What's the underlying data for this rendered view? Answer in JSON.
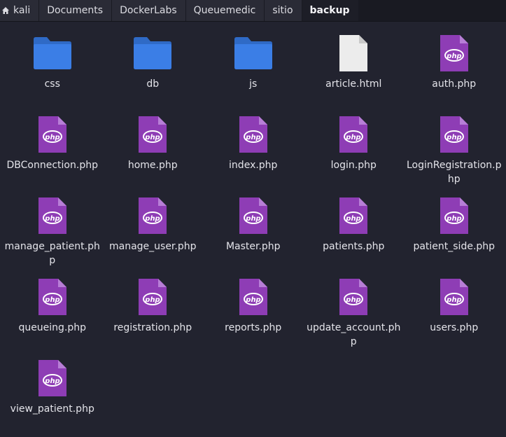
{
  "breadcrumbs": [
    {
      "label": "kali",
      "icon": "home-icon"
    },
    {
      "label": "Documents"
    },
    {
      "label": "DockerLabs"
    },
    {
      "label": "Queuemedic"
    },
    {
      "label": "sitio"
    },
    {
      "label": "backup",
      "active": true
    }
  ],
  "colors": {
    "folder": "#3b7ee6",
    "php": "#8e3db5",
    "html": "#ececec"
  },
  "php_badge_text": "php",
  "files": [
    {
      "name": "css",
      "type": "folder"
    },
    {
      "name": "db",
      "type": "folder"
    },
    {
      "name": "js",
      "type": "folder"
    },
    {
      "name": "article.html",
      "type": "html"
    },
    {
      "name": "auth.php",
      "type": "php"
    },
    {
      "name": "DBConnection.php",
      "type": "php"
    },
    {
      "name": "home.php",
      "type": "php"
    },
    {
      "name": "index.php",
      "type": "php"
    },
    {
      "name": "login.php",
      "type": "php"
    },
    {
      "name": "LoginRegistration.php",
      "type": "php"
    },
    {
      "name": "manage_patient.php",
      "type": "php"
    },
    {
      "name": "manage_user.php",
      "type": "php"
    },
    {
      "name": "Master.php",
      "type": "php"
    },
    {
      "name": "patients.php",
      "type": "php"
    },
    {
      "name": "patient_side.php",
      "type": "php"
    },
    {
      "name": "queueing.php",
      "type": "php"
    },
    {
      "name": "registration.php",
      "type": "php"
    },
    {
      "name": "reports.php",
      "type": "php"
    },
    {
      "name": "update_account.php",
      "type": "php"
    },
    {
      "name": "users.php",
      "type": "php"
    },
    {
      "name": "view_patient.php",
      "type": "php"
    }
  ]
}
